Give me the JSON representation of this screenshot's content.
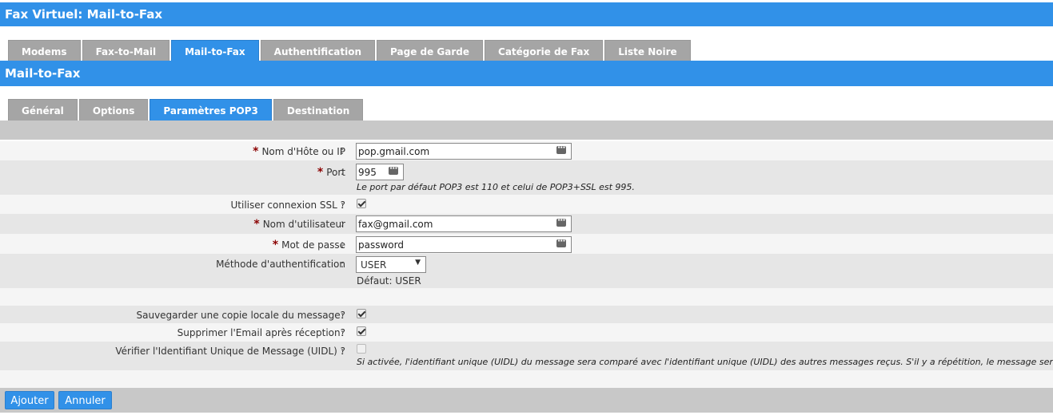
{
  "header": {
    "title": "Fax Virtuel:  Mail-to-Fax"
  },
  "main_tabs": [
    {
      "label": "Modems"
    },
    {
      "label": "Fax-to-Mail"
    },
    {
      "label": "Mail-to-Fax"
    },
    {
      "label": "Authentification"
    },
    {
      "label": "Page de Garde"
    },
    {
      "label": "Catégorie de Fax"
    },
    {
      "label": "Liste Noire"
    }
  ],
  "section": {
    "title": "Mail-to-Fax"
  },
  "sub_tabs": [
    {
      "label": "Général"
    },
    {
      "label": "Options"
    },
    {
      "label": "Paramètres POP3"
    },
    {
      "label": "Destination"
    }
  ],
  "form": {
    "host": {
      "label": "Nom d'Hôte ou IP",
      "value": "pop.gmail.com"
    },
    "port": {
      "label": "Port",
      "value": "995",
      "hint": "Le port par défaut POP3 est 110 et celui de POP3+SSL est 995."
    },
    "ssl": {
      "label": "Utiliser connexion SSL ?",
      "checked": true
    },
    "username": {
      "label": "Nom d'utilisateur",
      "value": "fax@gmail.com"
    },
    "password": {
      "label": "Mot de passe",
      "value": "password"
    },
    "auth": {
      "label": "Méthode d'authentification",
      "value": "USER",
      "default_text": "Défaut: USER"
    },
    "save_copy": {
      "label": "Sauvegarder une copie locale du message?",
      "checked": true
    },
    "delete_email": {
      "label": "Supprimer l'Email après réception?",
      "checked": true
    },
    "uidl": {
      "label": "Vérifier l'Identifiant Unique de Message (UIDL) ?",
      "checked": false,
      "hint": "Si activée, l'identifiant unique (UIDL) du message sera comparé avec l'identifiant unique (UIDL) des autres messages reçus. S'il y a répétition, le message sera ignoré."
    },
    "required_mark": "*",
    "colon": ":"
  },
  "buttons": {
    "add": "Ajouter",
    "cancel": "Annuler"
  },
  "colors": {
    "accent": "#3191e8",
    "tab_inactive": "#a5a5a5",
    "required": "#8b0000"
  }
}
